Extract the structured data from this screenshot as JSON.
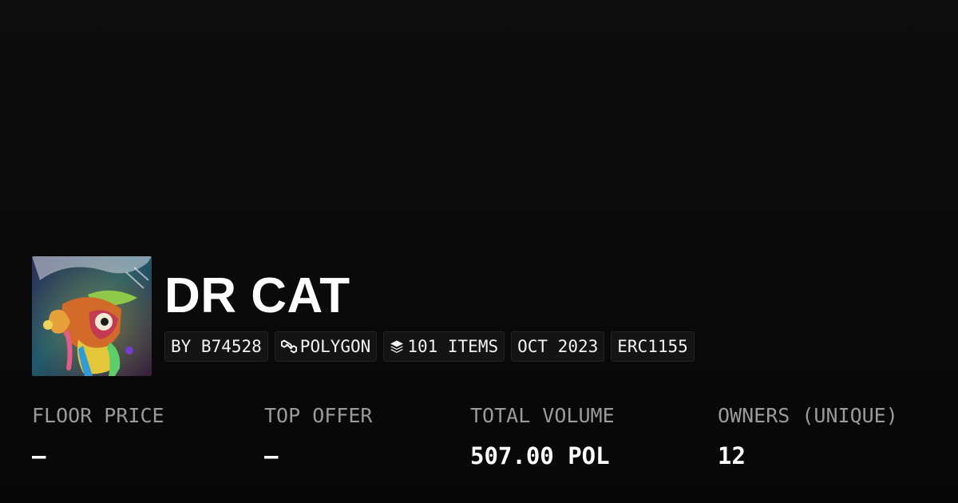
{
  "collection": {
    "title": "DR CAT",
    "avatar_icon": "psychedelic-cat-artwork"
  },
  "chips": [
    {
      "label": "BY B74528"
    },
    {
      "label": "POLYGON",
      "icon": "polygon-chain-icon"
    },
    {
      "label": "101 ITEMS",
      "icon": "layers-icon"
    },
    {
      "label": "OCT 2023"
    },
    {
      "label": "ERC1155"
    }
  ],
  "stats": [
    {
      "label": "FLOOR PRICE",
      "value": "–"
    },
    {
      "label": "TOP OFFER",
      "value": "–"
    },
    {
      "label": "TOTAL VOLUME",
      "value": "507.00 POL"
    },
    {
      "label": "OWNERS (UNIQUE)",
      "value": "12"
    }
  ]
}
